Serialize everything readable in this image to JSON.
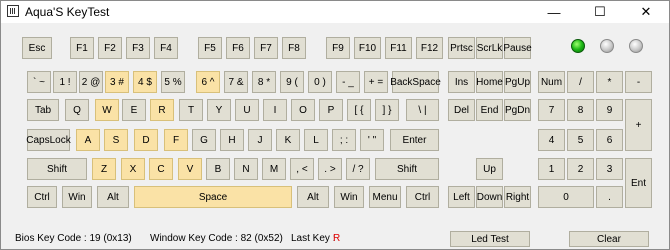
{
  "window": {
    "title": "Aqua'S KeyTest",
    "controls": [
      "—",
      "☐",
      "✕"
    ]
  },
  "keys": {
    "esc": "Esc",
    "f1": "F1",
    "f2": "F2",
    "f3": "F3",
    "f4": "F4",
    "f5": "F5",
    "f6": "F6",
    "f7": "F7",
    "f8": "F8",
    "f9": "F9",
    "f10": "F10",
    "f11": "F11",
    "f12": "F12",
    "prtsc": "Prtsc",
    "scrlk": "ScrLk",
    "pause": "Pause",
    "backtick": "` ~",
    "k1": "1 !",
    "k2": "2 @",
    "k3": "3 #",
    "k4": "4 $",
    "k5": "5 %",
    "k6": "6 ^",
    "k7": "7 &",
    "k8": "8 *",
    "k9": "9 (",
    "k0": "0 )",
    "minus": "- _",
    "equals": "+ =",
    "backspace": "BackSpace",
    "tab": "Tab",
    "q": "Q",
    "w": "W",
    "e": "E",
    "r": "R",
    "t": "T",
    "y": "Y",
    "u": "U",
    "i": "I",
    "o": "O",
    "p": "P",
    "lbracket": "[ {",
    "rbracket": "] }",
    "backslash": "\\ |",
    "capslock": "CapsLock",
    "a": "A",
    "s": "S",
    "d": "D",
    "f": "F",
    "g": "G",
    "h": "H",
    "j": "J",
    "k": "K",
    "l": "L",
    "semicolon": "; :",
    "quote": "' \"",
    "enter": "Enter",
    "lshift": "Shift",
    "z": "Z",
    "x": "X",
    "c": "C",
    "v": "V",
    "b": "B",
    "n": "N",
    "m": "M",
    "comma": ", <",
    "period": ". >",
    "slash": "/ ?",
    "rshift": "Shift",
    "lctrl": "Ctrl",
    "lwin": "Win",
    "lalt": "Alt",
    "space": "Space",
    "ralt": "Alt",
    "rwin": "Win",
    "menu": "Menu",
    "rctrl": "Ctrl",
    "ins": "Ins",
    "home": "Home",
    "pgup": "PgUp",
    "del": "Del",
    "end": "End",
    "pgdn": "PgDn",
    "up": "Up",
    "left": "Left",
    "down": "Down",
    "right": "Right",
    "numlock": "Num",
    "numdiv": "/",
    "nummul": "*",
    "numsub": "-",
    "num7": "7",
    "num8": "8",
    "num9": "9",
    "numadd": "+",
    "num4": "4",
    "num5": "5",
    "num6": "6",
    "num1": "1",
    "num2": "2",
    "num3": "3",
    "numenter": "Ent",
    "num0": "0",
    "numdot": "."
  },
  "leds": {
    "num_lock": "on",
    "caps_lock": "off",
    "scroll_lock": "off"
  },
  "status": {
    "bios_key_code": "Bios Key Code : 19 (0x13)",
    "window_key_code": "Window Key Code : 82 (0x52)",
    "last_key_label": "Last Key :",
    "last_key_value": "R",
    "led_test_button": "Led Test",
    "clear_button": "Clear"
  },
  "colors": {
    "key_normal": "#e1dfd3",
    "key_pressed": "#fae2a6",
    "led_on": "#1db816",
    "last_key": "#e00000"
  }
}
